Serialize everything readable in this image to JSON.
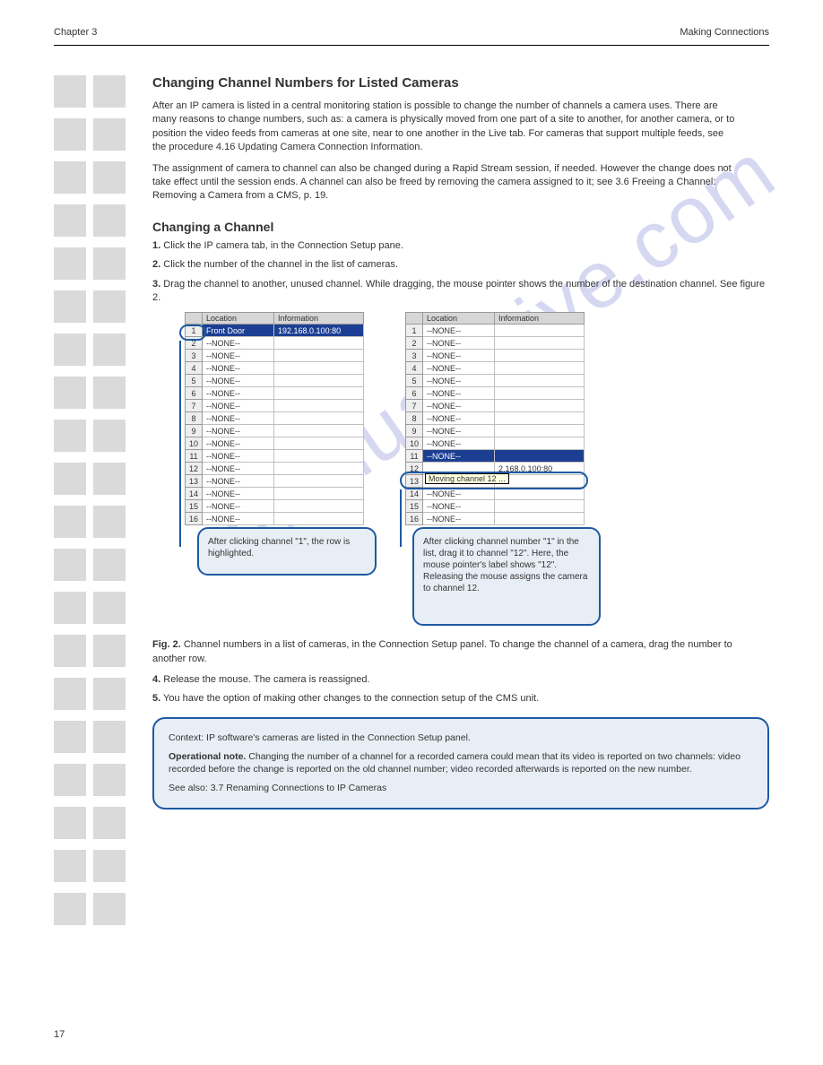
{
  "header": {
    "left_title": "Chapter 3",
    "right_title": "Making Connections"
  },
  "headings": {
    "h1": "Changing Channel Numbers for Listed Cameras",
    "h2": "Changing a Channel"
  },
  "intro": {
    "p1": "After an IP camera is listed in a central monitoring station is possible to change the number of channels a camera uses. There are many reasons to change numbers, such as: a camera is physically moved from one part of a site to another, for another camera, or to position the video feeds from cameras at one site, near to one another in the Live tab. For cameras that support multiple feeds, see the procedure 4.16 Updating Camera Connection Information.",
    "p2": "The assignment of camera to channel can also be changed during a Rapid Stream session, if needed. However the change does not take effect until the session ends. A channel can also be freed by removing the camera assigned to it; see 3.6 Freeing a Channel: Removing a Camera from a CMS, p. 19."
  },
  "steps": {
    "s1_num": "1.",
    "s1_text": " Click the IP camera tab, in the Connection Setup pane.",
    "s2_num": "2.",
    "s2_text": " Click the number of the channel in the list of cameras.",
    "s3_num": "3.",
    "s3_text": " Drag the channel to another, unused channel. While dragging, the mouse pointer shows the number of the destination channel. See figure 2.",
    "s4_num": "4.",
    "s4_text": " Release the mouse. The camera is reassigned.",
    "s5_num": "5.",
    "s5_text": " You have the option of making other changes to the connection setup of the CMS unit."
  },
  "table": {
    "cols": {
      "num": "",
      "loc": "Location",
      "info": "Information"
    },
    "none": "--NONE--"
  },
  "left_table": {
    "row1_loc": "Front Door",
    "row1_info": "192.168.0.100:80"
  },
  "right_table": {
    "row12_tooltip": "Moving channel 12 ...",
    "row12_info": "2.168.0.100:80"
  },
  "callouts": {
    "left": "After clicking channel \"1\", the row is highlighted.",
    "right": "After clicking channel number \"1\" in the list, drag it to channel \"12\". Here, the mouse pointer's label shows \"12\". Releasing the mouse assigns the camera to channel 12."
  },
  "figure": {
    "label": "Fig. 2.",
    "text": "Channel numbers in a list of cameras, in the Connection Setup panel. To change the channel of a camera, drag the number to another row."
  },
  "note": {
    "context": "Context: IP software's cameras are listed in the Connection Setup panel.",
    "op_label": "Operational note. ",
    "op_text": "Changing the number of a channel for a recorded camera could mean that its video is reported on two channels: video recorded before the change is reported on the old channel number; video recorded afterwards is reported on the new number.",
    "see_also": "See also: 3.7 Renaming Connections to IP Cameras"
  },
  "pagenum": "17"
}
